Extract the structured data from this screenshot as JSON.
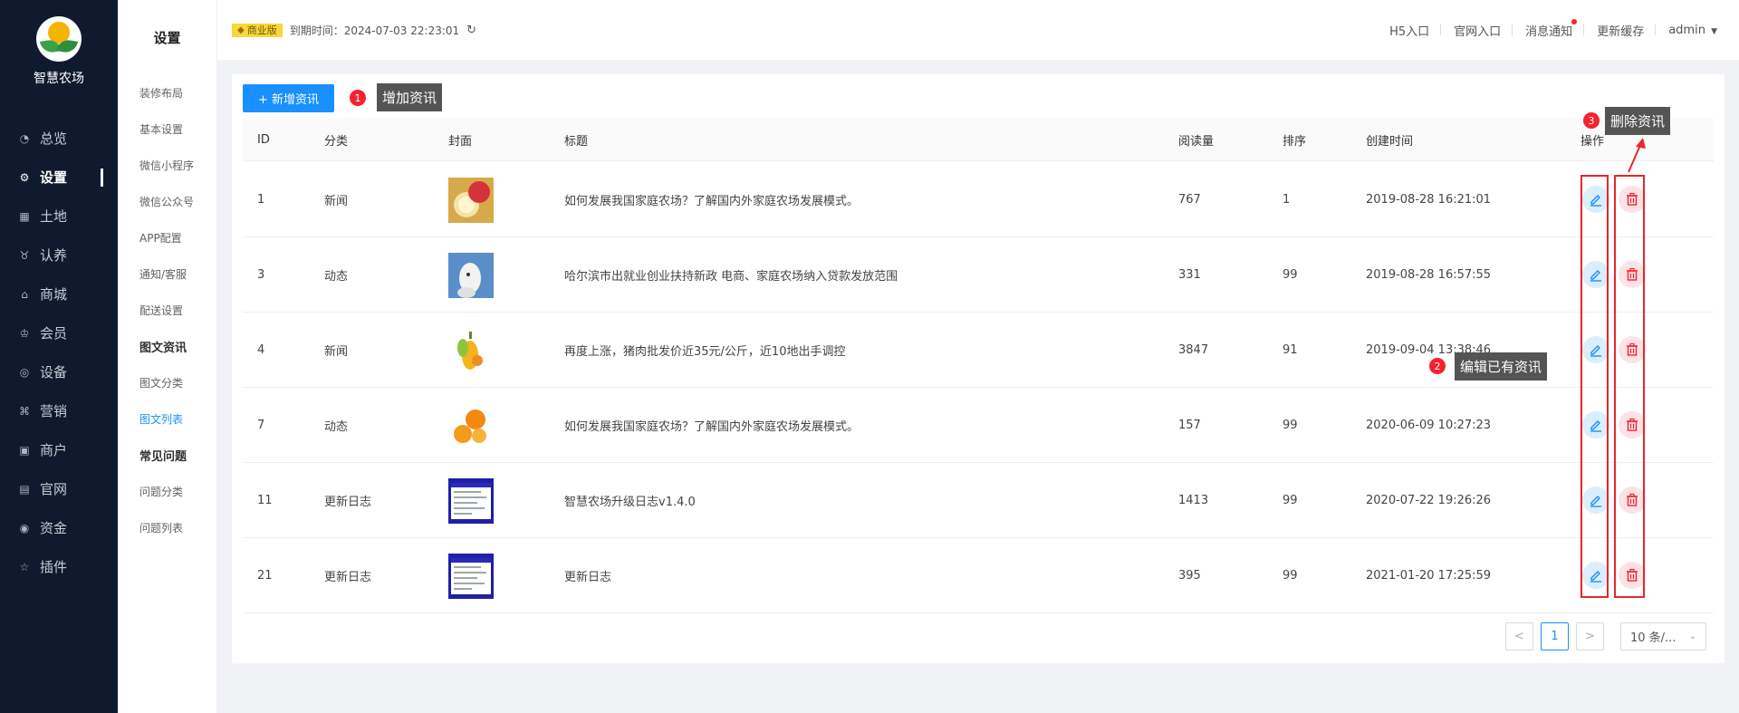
{
  "brand": {
    "name": "智慧农场"
  },
  "sidebar": {
    "items": [
      {
        "label": "总览",
        "icon": "dashboard-icon"
      },
      {
        "label": "设置",
        "icon": "gear-icon",
        "active": true
      },
      {
        "label": "土地",
        "icon": "grid-icon"
      },
      {
        "label": "认养",
        "icon": "adopt-icon"
      },
      {
        "label": "商城",
        "icon": "shop-icon"
      },
      {
        "label": "会员",
        "icon": "member-icon"
      },
      {
        "label": "设备",
        "icon": "device-icon"
      },
      {
        "label": "营销",
        "icon": "marketing-icon"
      },
      {
        "label": "商户",
        "icon": "merchant-icon"
      },
      {
        "label": "官网",
        "icon": "website-icon"
      },
      {
        "label": "资金",
        "icon": "money-icon"
      },
      {
        "label": "插件",
        "icon": "star-icon"
      }
    ]
  },
  "submenu": {
    "title": "设置",
    "items": [
      {
        "label": "装修布局"
      },
      {
        "label": "基本设置"
      },
      {
        "label": "微信小程序"
      },
      {
        "label": "微信公众号"
      },
      {
        "label": "APP配置"
      },
      {
        "label": "通知/客服"
      },
      {
        "label": "配送设置"
      },
      {
        "label": "图文资讯",
        "group": true
      },
      {
        "label": "图文分类"
      },
      {
        "label": "图文列表",
        "active": true
      },
      {
        "label": "常见问题",
        "group": true
      },
      {
        "label": "问题分类"
      },
      {
        "label": "问题列表"
      }
    ]
  },
  "topbar": {
    "edition": "商业版",
    "expire": "到期时间：2024-07-03 22:23:01",
    "links": [
      "H5入口",
      "官网入口",
      "消息通知",
      "更新缓存"
    ],
    "user": "admin"
  },
  "toolbar": {
    "add_label": "+ 新增资讯"
  },
  "callouts": {
    "add": {
      "num": "1",
      "text": "增加资讯"
    },
    "edit": {
      "num": "2",
      "text": "编辑已有资讯"
    },
    "delete": {
      "num": "3",
      "text": "删除资讯"
    }
  },
  "table": {
    "headers": {
      "id": "ID",
      "category": "分类",
      "cover": "封面",
      "title": "标题",
      "views": "阅读量",
      "sort": "排序",
      "created": "创建时间",
      "ops": "操作"
    },
    "rows": [
      {
        "id": "1",
        "category": "新闻",
        "title": "如何发展我国家庭农场？了解国内外家庭农场发展模式。",
        "views": "767",
        "sort": "1",
        "created": "2019-08-28 16:21:01",
        "cover": "apple-pear-cover"
      },
      {
        "id": "3",
        "category": "动态",
        "title": "哈尔滨市出就业创业扶持新政 电商、家庭农场纳入贷款发放范围",
        "views": "331",
        "sort": "99",
        "created": "2019-08-28 16:57:55",
        "cover": "goat-cover"
      },
      {
        "id": "4",
        "category": "新闻",
        "title": "再度上涨，猪肉批发价近35元/公斤，近10地出手调控",
        "views": "3847",
        "sort": "91",
        "created": "2019-09-04 13:38:46",
        "cover": "fruit-splash-cover"
      },
      {
        "id": "7",
        "category": "动态",
        "title": "如何发展我国家庭农场？了解国内外家庭农场发展模式。",
        "views": "157",
        "sort": "99",
        "created": "2020-06-09 10:27:23",
        "cover": "oranges-cover"
      },
      {
        "id": "11",
        "category": "更新日志",
        "title": "智慧农场升级日志v1.4.0",
        "views": "1413",
        "sort": "99",
        "created": "2020-07-22 19:26:26",
        "cover": "changelog-cover"
      },
      {
        "id": "21",
        "category": "更新日志",
        "title": "更新日志",
        "views": "395",
        "sort": "99",
        "created": "2021-01-20 17:25:59",
        "cover": "changelog-cover"
      }
    ]
  },
  "pagination": {
    "prev": "<",
    "current": "1",
    "next": ">",
    "page_size": "10 条/..."
  }
}
